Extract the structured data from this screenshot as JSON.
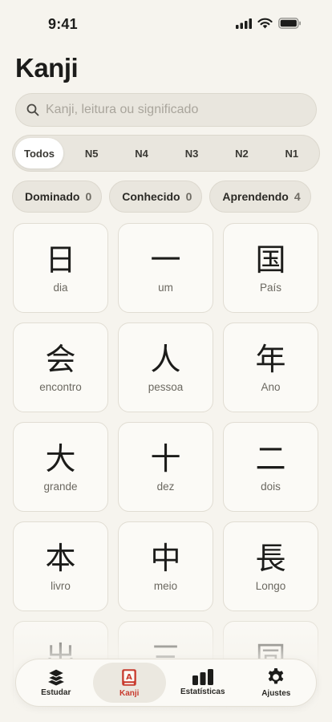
{
  "status_bar": {
    "time": "9:41"
  },
  "header": {
    "title": "Kanji"
  },
  "search": {
    "placeholder": "Kanji, leitura ou significado"
  },
  "levels": [
    "Todos",
    "N5",
    "N4",
    "N3",
    "N2",
    "N1"
  ],
  "chips": [
    {
      "label": "Dominado",
      "count": "0"
    },
    {
      "label": "Conhecido",
      "count": "0"
    },
    {
      "label": "Aprendendo",
      "count": "4"
    }
  ],
  "kanji_cards": [
    {
      "kanji": "日",
      "meaning": "dia"
    },
    {
      "kanji": "一",
      "meaning": "um"
    },
    {
      "kanji": "国",
      "meaning": "País"
    },
    {
      "kanji": "会",
      "meaning": "encontro"
    },
    {
      "kanji": "人",
      "meaning": "pessoa"
    },
    {
      "kanji": "年",
      "meaning": "Ano"
    },
    {
      "kanji": "大",
      "meaning": "grande"
    },
    {
      "kanji": "十",
      "meaning": "dez"
    },
    {
      "kanji": "二",
      "meaning": "dois"
    },
    {
      "kanji": "本",
      "meaning": "livro"
    },
    {
      "kanji": "中",
      "meaning": "meio"
    },
    {
      "kanji": "長",
      "meaning": "Longo"
    },
    {
      "kanji": "出",
      "meaning": ""
    },
    {
      "kanji": "三",
      "meaning": ""
    },
    {
      "kanji": "同",
      "meaning": ""
    }
  ],
  "tabbar": {
    "items": [
      {
        "label": "Estudar",
        "icon": "layers-icon"
      },
      {
        "label": "Kanji",
        "icon": "kanji-book-icon"
      },
      {
        "label": "Estatísticas",
        "icon": "bar-chart-icon"
      },
      {
        "label": "Ajustes",
        "icon": "gear-icon"
      }
    ]
  },
  "colors": {
    "background": "#f6f4ee",
    "accent": "#c83b2e"
  }
}
